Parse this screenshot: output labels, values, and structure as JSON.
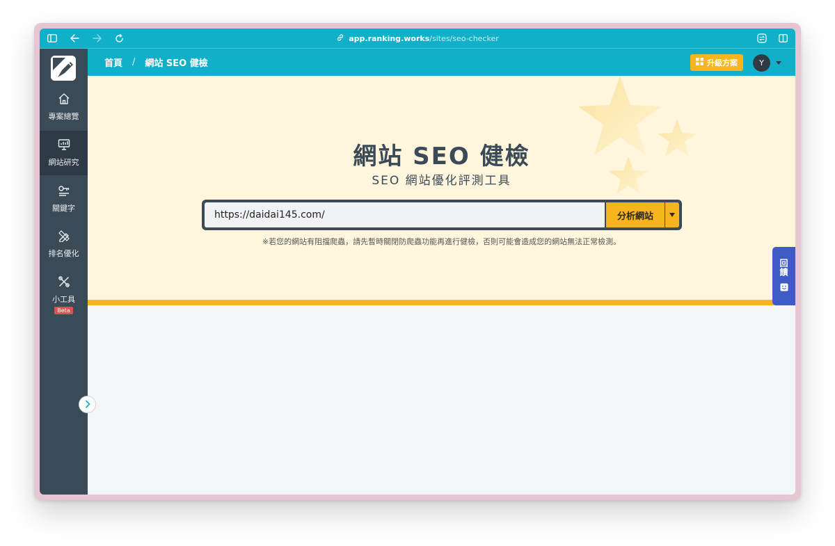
{
  "browser": {
    "url_host": "app.ranking.works",
    "url_path": "/sites/seo-checker"
  },
  "header": {
    "breadcrumbs": [
      "首頁",
      "網站 SEO 健檢"
    ],
    "breadcrumb_separator": "/",
    "upgrade_label": "升級方案",
    "avatar_initial": "Y"
  },
  "sidebar": {
    "items": [
      {
        "label": "專案總覽",
        "icon": "home-icon"
      },
      {
        "label": "網站研究",
        "icon": "monitor-chart-icon"
      },
      {
        "label": "關鍵字",
        "icon": "key-icon"
      },
      {
        "label": "排名優化",
        "icon": "pencil-ruler-icon"
      },
      {
        "label": "小工具",
        "icon": "tools-icon",
        "badge": "Beta"
      }
    ]
  },
  "hero": {
    "title": "網站 SEO 健檢",
    "subtitle": "SEO 網站優化評測工具",
    "search_value": "https://daidai145.com/",
    "analyze_label": "分析網站",
    "hint": "※若您的網站有阻擋爬蟲，請先暫時關閉防爬蟲功能再進行健檢，否則可能會造成您的網站無法正常檢測。"
  },
  "feedback": {
    "label": "回饋"
  },
  "colors": {
    "brand_cyan": "#0fb0c8",
    "sidebar_dark": "#3b4a57",
    "accent_yellow": "#f6b51c",
    "hero_bg": "#fff6dd",
    "feedback_blue": "#3f5cc6",
    "window_frame": "#e7c6d3"
  }
}
